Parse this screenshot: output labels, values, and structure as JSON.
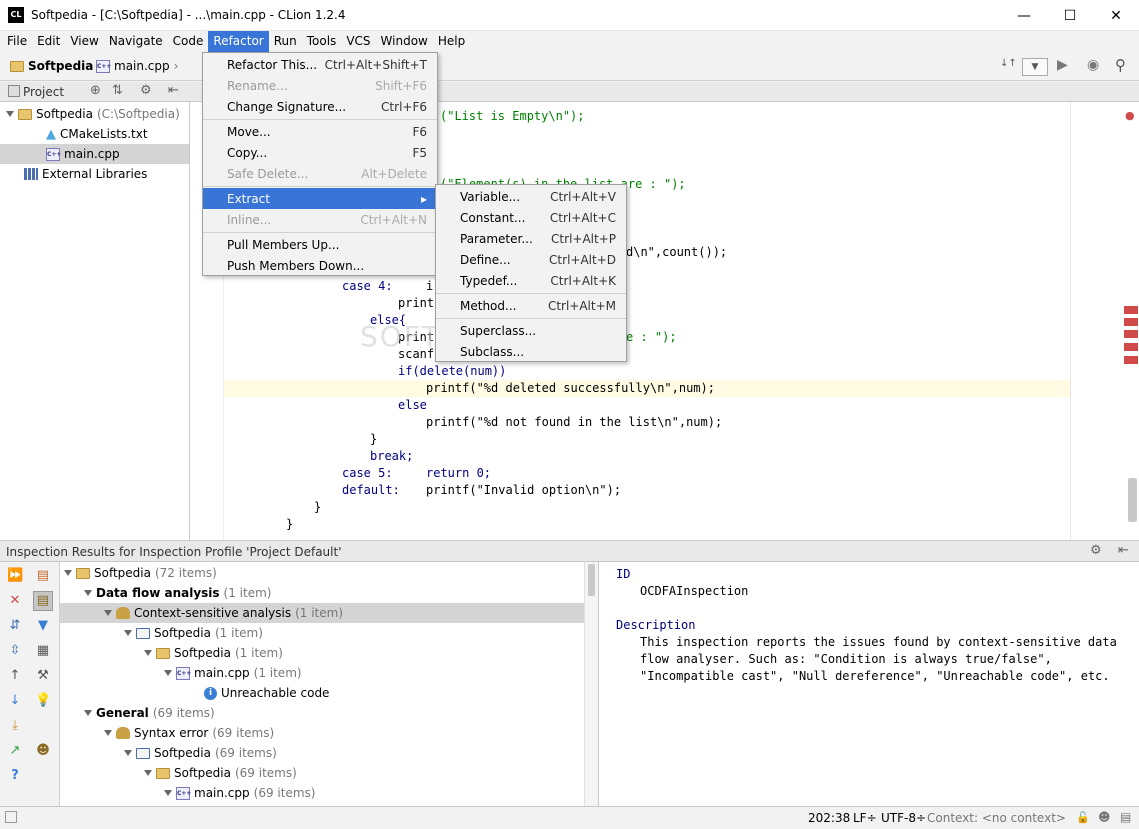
{
  "window": {
    "title": "Softpedia - [C:\\Softpedia] - ...\\main.cpp - CLion 1.2.4",
    "app_icon": "CL"
  },
  "menubar": [
    "File",
    "Edit",
    "View",
    "Navigate",
    "Code",
    "Refactor",
    "Run",
    "Tools",
    "VCS",
    "Window",
    "Help"
  ],
  "breadcrumb": {
    "project": "Softpedia",
    "file": "main.cpp"
  },
  "project_panel": {
    "header": "Project",
    "root": "Softpedia",
    "root_path": "(C:\\Softpedia)",
    "files": [
      "CMakeLists.txt",
      "main.cpp"
    ],
    "external": "External Libraries"
  },
  "refactor_menu": {
    "items": [
      {
        "label": "Refactor This...",
        "shortcut": "Ctrl+Alt+Shift+T",
        "disabled": false
      },
      {
        "label": "Rename...",
        "shortcut": "Shift+F6",
        "disabled": true
      },
      {
        "label": "Change Signature...",
        "shortcut": "Ctrl+F6",
        "disabled": false
      },
      {
        "label": "Move...",
        "shortcut": "F6",
        "disabled": false
      },
      {
        "label": "Copy...",
        "shortcut": "F5",
        "disabled": false
      },
      {
        "label": "Safe Delete...",
        "shortcut": "Alt+Delete",
        "disabled": true
      },
      {
        "label": "Extract",
        "shortcut": "",
        "disabled": false
      },
      {
        "label": "Inline...",
        "shortcut": "Ctrl+Alt+N",
        "disabled": true
      },
      {
        "label": "Pull Members Up...",
        "shortcut": "",
        "disabled": false
      },
      {
        "label": "Push Members Down...",
        "shortcut": "",
        "disabled": false
      }
    ]
  },
  "extract_menu": {
    "items": [
      {
        "label": "Variable...",
        "shortcut": "Ctrl+Alt+V"
      },
      {
        "label": "Constant...",
        "shortcut": "Ctrl+Alt+C"
      },
      {
        "label": "Parameter...",
        "shortcut": "Ctrl+Alt+P"
      },
      {
        "label": "Define...",
        "shortcut": "Ctrl+Alt+D"
      },
      {
        "label": "Typedef...",
        "shortcut": "Ctrl+Alt+K"
      },
      {
        "label": "Method...",
        "shortcut": "Ctrl+Alt+M"
      },
      {
        "label": "Superclass...",
        "shortcut": ""
      },
      {
        "label": "Subclass...",
        "shortcut": ""
      }
    ]
  },
  "code": {
    "l1": "(\"List is Empty\\n\");",
    "l2": "(\"Element(s) in the list are : \");",
    "l3": "d\\n\",count());",
    "l4_case": "case 4:",
    "l4_rest": "i",
    "l5": "print",
    "l6": "else{",
    "l7": "print",
    "l7b": "e : \");",
    "l8": "scanf",
    "l9": "if(delete(num))",
    "l10": "printf(\"%d deleted successfully\\n\",num);",
    "l11": "else",
    "l12": "printf(\"%d not found in the list\\n\",num);",
    "l13": "}",
    "l14": "break;",
    "l15_case": "case 5:",
    "l15_rest": "return 0;",
    "l16_case": "default:",
    "l16_rest": "printf(\"Invalid option\\n\");",
    "l17": "}",
    "l18": "}"
  },
  "inspection": {
    "header": "Inspection Results for Inspection Profile 'Project Default'",
    "tree": [
      {
        "label": "Softpedia",
        "count": "(72 items)"
      },
      {
        "label": "Data flow analysis",
        "count": "(1 item)"
      },
      {
        "label": "Context-sensitive analysis",
        "count": "(1 item)"
      },
      {
        "label": "Softpedia",
        "count": "(1 item)"
      },
      {
        "label": "Softpedia",
        "count": "(1 item)"
      },
      {
        "label": "main.cpp",
        "count": "(1 item)"
      },
      {
        "label": "Unreachable code",
        "count": ""
      },
      {
        "label": "General",
        "count": "(69 items)"
      },
      {
        "label": "Syntax error",
        "count": "(69 items)"
      },
      {
        "label": "Softpedia",
        "count": "(69 items)"
      },
      {
        "label": "Softpedia",
        "count": "(69 items)"
      },
      {
        "label": "main.cpp",
        "count": "(69 items)"
      }
    ],
    "id_label": "ID",
    "id_value": "OCDFAInspection",
    "desc_label": "Description",
    "desc_lines": [
      "This inspection reports the issues found by context-sensitive data",
      "flow analyser. Such as: \"Condition is always true/false\",",
      "\"Incompatible cast\", \"Null dereference\", \"Unreachable code\", etc."
    ]
  },
  "status": {
    "position": "202:38",
    "line_sep": "LF÷",
    "encoding": "UTF-8÷",
    "context": "Context: <no context>"
  },
  "watermark": "SOFTPEDIA"
}
